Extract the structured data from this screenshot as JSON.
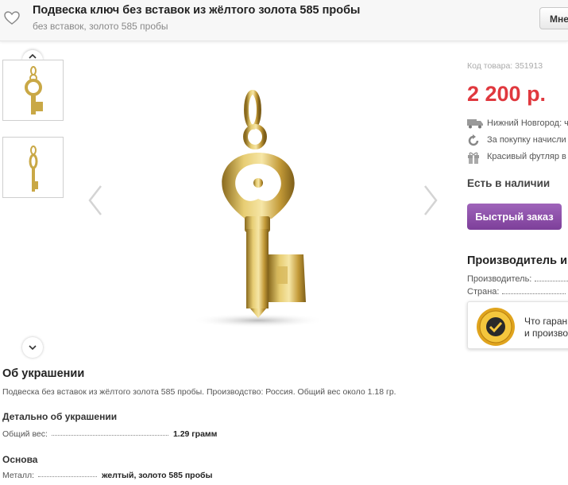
{
  "header": {
    "title": "Подвеска ключ без вставок из жёлтого золота 585 пробы",
    "subtitle": "без вставок, золото 585 пробы",
    "button_label": "Мне",
    "favorite_icon": "heart-outline-icon"
  },
  "product": {
    "sku": "Код товара: 351913",
    "price": "2 200 р.",
    "price_color": "#e0383e",
    "features": [
      {
        "icon": "truck-icon",
        "text": "Нижний Новгород: ч"
      },
      {
        "icon": "refresh-icon",
        "text": "За покупку начисли"
      },
      {
        "icon": "gift-icon",
        "text": "Красивый футляр в"
      }
    ],
    "stock": "Есть в наличии",
    "quick_order_label": "Быстрый заказ",
    "quick_order_color": "#8a4ba8"
  },
  "manufacturer": {
    "heading": "Производитель и",
    "rows": [
      {
        "label": "Производитель:"
      },
      {
        "label": "Страна:"
      }
    ],
    "guarantee_line1": "Что гаран",
    "guarantee_line2": "и произво",
    "badge_icon": "money-back-guarantee-seal-icon"
  },
  "about": {
    "heading": "Об украшении",
    "text": "Подвеска без вставок из жёлтого золота 585 пробы. Производство: Россия. Общий вес около 1.18 гр."
  },
  "details": {
    "heading": "Детально об украшении",
    "weight_label": "Общий вес:",
    "weight_value": "1.29 грамм",
    "base_heading": "Основа",
    "metal_label": "Металл:",
    "metal_value": "желтый, золото 585 пробы"
  }
}
